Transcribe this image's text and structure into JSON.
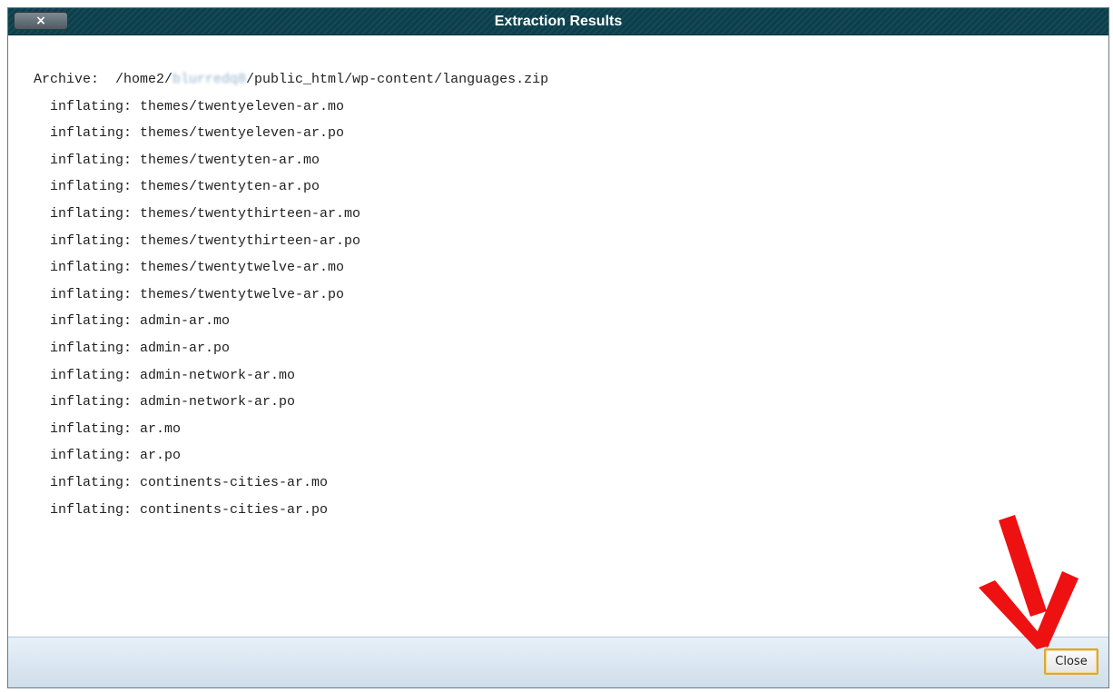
{
  "dialog": {
    "title": "Extraction Results",
    "close_x_label": "×",
    "close_button_label": "Close"
  },
  "output": {
    "archive_label": "Archive:  ",
    "archive_path_prefix": "/home2/",
    "archive_path_redacted": "blurredq8",
    "archive_path_suffix": "/public_html/wp-content/languages.zip",
    "lines": [
      "  inflating: themes/twentyeleven-ar.mo",
      "  inflating: themes/twentyeleven-ar.po",
      "  inflating: themes/twentyten-ar.mo",
      "  inflating: themes/twentyten-ar.po",
      "  inflating: themes/twentythirteen-ar.mo",
      "  inflating: themes/twentythirteen-ar.po",
      "  inflating: themes/twentytwelve-ar.mo",
      "  inflating: themes/twentytwelve-ar.po",
      "  inflating: admin-ar.mo",
      "  inflating: admin-ar.po",
      "  inflating: admin-network-ar.mo",
      "  inflating: admin-network-ar.po",
      "  inflating: ar.mo",
      "  inflating: ar.po",
      "  inflating: continents-cities-ar.mo",
      "  inflating: continents-cities-ar.po"
    ]
  },
  "colors": {
    "titlebar": "#0b3f4c",
    "footer": "#d7e4ef",
    "arrow": "#ee1111",
    "button_border": "#d9a83a"
  },
  "icons": {
    "close": "close-icon",
    "annotation": "red-arrow-icon"
  }
}
